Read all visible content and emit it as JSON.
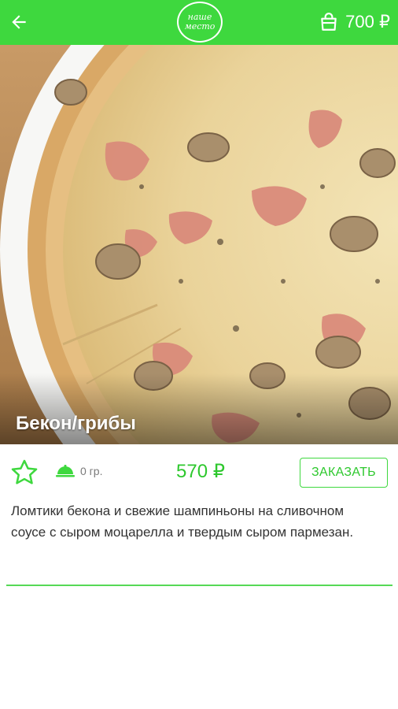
{
  "header": {
    "logo_line1": "наше",
    "logo_line2": "место",
    "cart_total": "700 ₽"
  },
  "product": {
    "title": "Бекон/грибы",
    "weight": "0 гр.",
    "price": "570 ₽",
    "order_label": "ЗАКАЗАТЬ",
    "description": "Ломтики бекона и свежие шампиньоны на сливочном соусе с сыром моцарелла и твердым сыром пармезан."
  },
  "colors": {
    "accent": "#3ed83e",
    "accent_text": "#2ec82e",
    "text": "#333333",
    "muted": "#7a7a7a"
  },
  "icons": [
    "back-arrow-icon",
    "shopping-bag-icon",
    "star-outline-icon",
    "dish-cover-icon"
  ]
}
